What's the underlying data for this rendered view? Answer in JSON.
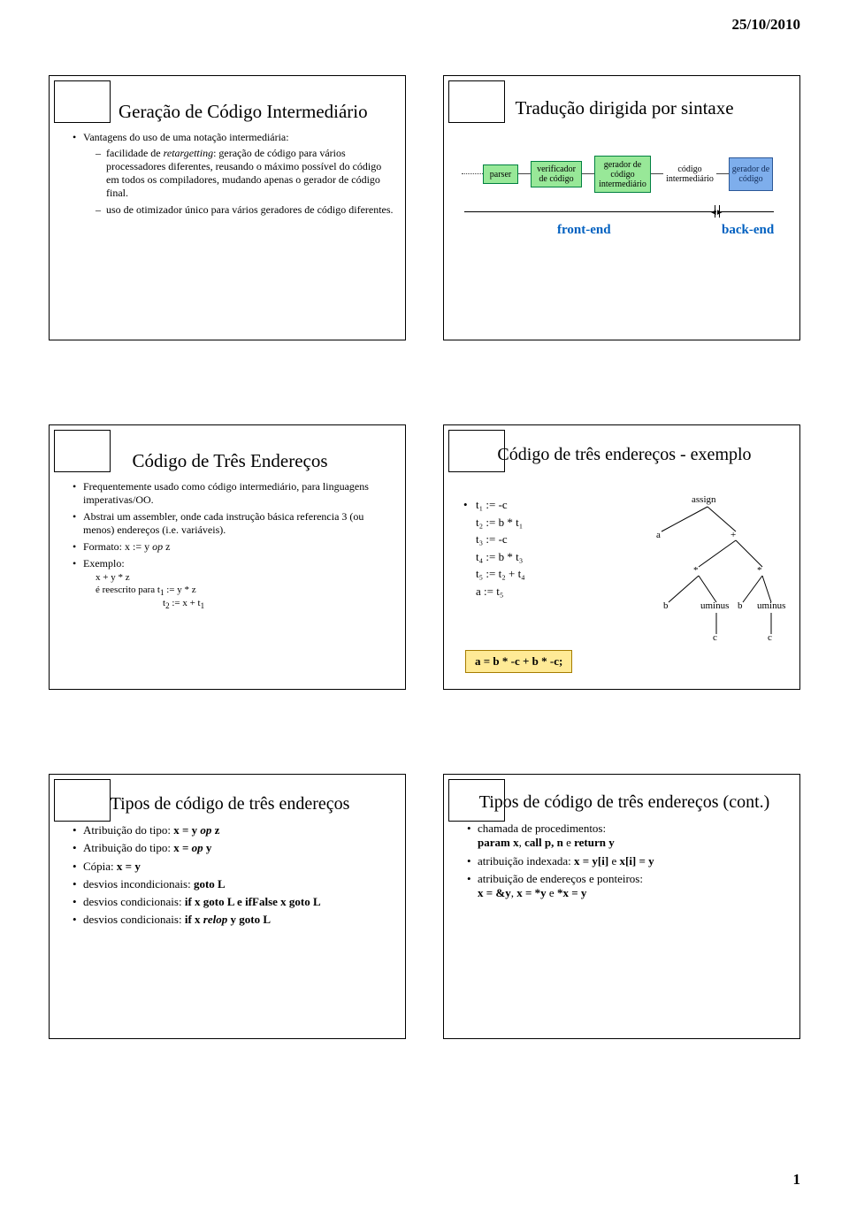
{
  "meta": {
    "date": "25/10/2010",
    "pagenum": "1"
  },
  "slide1": {
    "title": "Geração de Código Intermediário",
    "b1": "Vantagens do uso de uma notação intermediária:",
    "d1_a": "facilidade de ",
    "d1_b": "retargetting",
    "d1_c": ": geração de código para vários processadores diferentes, reusando o máximo possível do código em todos os compiladores, mudando apenas o gerador de código final.",
    "d2": "uso de otimizador único para vários geradores de código diferentes."
  },
  "slide2": {
    "title": "Tradução dirigida por sintaxe",
    "box1": "parser",
    "box2": "verificador de código",
    "box3": "gerador de código intermediário",
    "box4": "código intermediário",
    "box5": "gerador de código",
    "front": "front-end",
    "back": "back-end"
  },
  "slide3": {
    "title": "Código de Três Endereços",
    "b1": "Frequentemente usado como código intermediário, para linguagens imperativas/OO.",
    "b2": "Abstrai um assembler, onde cada instrução básica referencia 3 (ou menos) endereços (i.e. variáveis).",
    "b3_a": "Formato: x := y ",
    "b3_b": "op",
    "b3_c": " z",
    "b4": "Exemplo:",
    "ex1": "x + y * z",
    "ex2_a": "é reescrito para  t",
    "ex2_b": " := y * z",
    "ex3_a": "t",
    "ex3_b": " := x + t"
  },
  "slide4": {
    "title": "Código de três endereços - exemplo",
    "c1": "t₁ := -c",
    "c2": "t₂ := b * t₁",
    "c3": "t₃ := -c",
    "c4": "t₄ := b * t₃",
    "c5": "t₅ := t₂ + t₄",
    "c6": "a := t₅",
    "codebox": "a = b * -c + b * -c;",
    "n_assign": "assign",
    "n_a": "a",
    "n_plus": "+",
    "n_star": "*",
    "n_b": "b",
    "n_uminus": "uminus",
    "n_c": "c"
  },
  "slide5": {
    "title": "Tipos de código de três endereços",
    "b1_a": "Atribuição do tipo: ",
    "b1_b": "x = y ",
    "b1_c": "op ",
    "b1_d": "z",
    "b2_a": "Atribuição do tipo: ",
    "b2_b": "x = ",
    "b2_c": "op ",
    "b2_d": "y",
    "b3_a": "Cópia: ",
    "b3_b": "x = y",
    "b4_a": "desvios incondicionais: ",
    "b4_b": "goto L",
    "b5_a": "desvios condicionais: ",
    "b5_b": "if x goto L e ifFalse x goto L",
    "b6_a": "desvios condicionais: ",
    "b6_b": "if x ",
    "b6_c": "relop ",
    "b6_d": "y goto L"
  },
  "slide6": {
    "title": "Tipos de código de três endereços (cont.)",
    "b1": "chamada de procedimentos:",
    "b1b_a": "param x",
    "b1b_b": ", ",
    "b1b_c": "call p, n",
    "b1b_d": " e ",
    "b1b_e": "return y",
    "b2_a": "atribuição indexada: ",
    "b2_b": "x = y[i]",
    "b2_c": " e ",
    "b2_d": "x[i] = y",
    "b3": "atribuição de endereços e ponteiros:",
    "b3b_a": "x = &y",
    "b3b_b": ", ",
    "b3b_c": "x = *y",
    "b3b_d": " e ",
    "b3b_e": "*x = y"
  }
}
